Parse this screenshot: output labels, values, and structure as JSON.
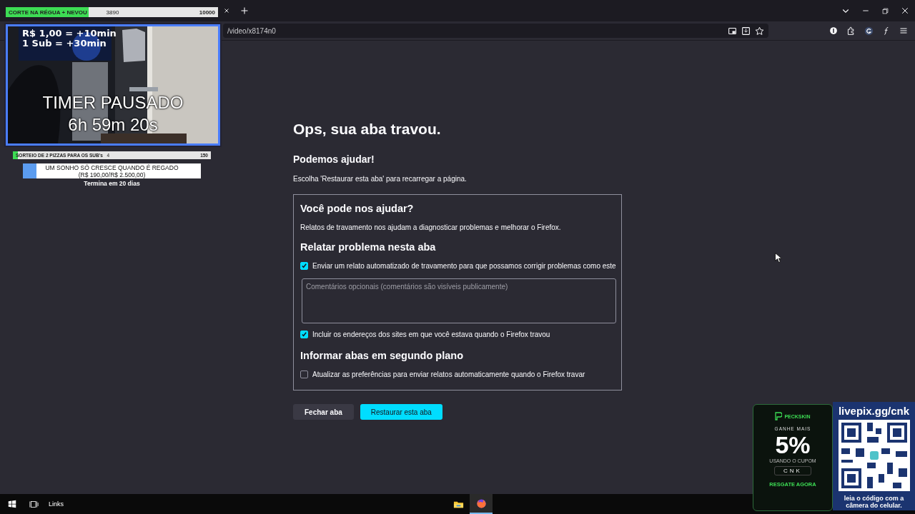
{
  "browser": {
    "url": "/video/x8174n0"
  },
  "crash_page": {
    "title": "Ops, sua aba travou.",
    "subtitle": "Podemos ajudar!",
    "instruction": "Escolha 'Restaurar esta aba' para recarregar a página.",
    "panel": {
      "heading": "Você pode nos ajudar?",
      "description": "Relatos de travamento nos ajudam a diagnosticar problemas e melhorar o Firefox.",
      "report_heading": "Relatar problema nesta aba",
      "send_option": {
        "label": "Enviar um relato automatizado de travamento para que possamos corrigir problemas como este",
        "checked": true
      },
      "comment_placeholder": "Comentários opcionais (comentários são visíveis publicamente)",
      "urls_option": {
        "label": "Incluir os endereços dos sites em que você estava quando o Firefox travou",
        "checked": true
      },
      "background_heading": "Informar abas em segundo plano",
      "background_option": {
        "label": "Atualizar as preferências para enviar relatos automaticamente quando o Firefox travar",
        "checked": false
      }
    },
    "buttons": [
      {
        "label": "Fechar aba",
        "kind": "secondary"
      },
      {
        "label": "Restaurar esta aba",
        "kind": "primary"
      }
    ]
  },
  "stream_overlay": {
    "goal_bar": {
      "label": "CORTE NA RÉGUA + NEVOU",
      "current": "3890",
      "target": "10000",
      "level": 0.389
    },
    "webcam": {
      "rate_lines": [
        "R$ 1,00 = +10min",
        "1 Sub = +30min"
      ],
      "timer_label": "TIMER PAUSADO",
      "timer_value": "6h 59m 20s"
    },
    "raffle_bar": {
      "label": "SORTEIO DE 2 PIZZAS PARA OS SUB's",
      "current": "4",
      "target": "150",
      "level": 0.027
    },
    "donation_goal": {
      "title": "UM SONHO SÓ CRESCE QUANDO É REGADO",
      "amount": "(R$ 190,00/R$ 2.500,00)",
      "level": 0.076,
      "ends": "Termina em 20 dias"
    },
    "ad": {
      "brand": "PECKSKIN",
      "tagline": "GANHE MAIS",
      "value": "5%",
      "coupon_hint": "USANDO O CUPOM",
      "coupon": "CNK",
      "cta": "RESGATE AGORA"
    },
    "pix": {
      "url": "livepix.gg/cnk",
      "caption": "leia o código com a câmera do celular."
    }
  },
  "taskbar": {
    "label": "Links",
    "apps": [
      {
        "kind": "folder",
        "selected": false
      },
      {
        "kind": "firefox",
        "selected": true
      }
    ]
  }
}
